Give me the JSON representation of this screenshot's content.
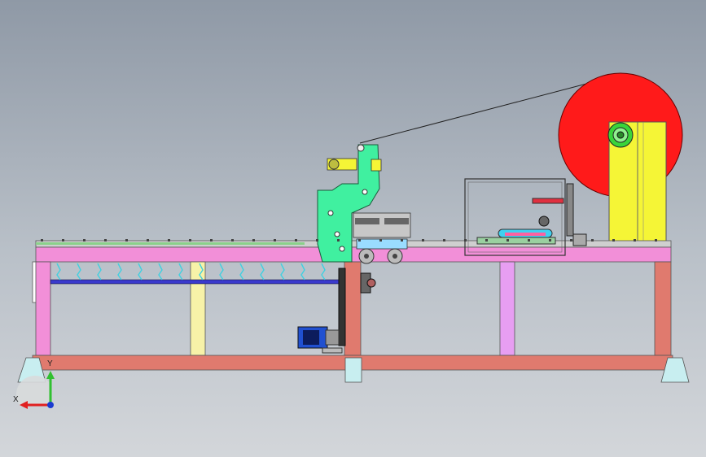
{
  "app": {
    "title": ""
  },
  "triad": {
    "x_label": "X",
    "y_label": "Y"
  },
  "colors": {
    "frame_pink": "#f28fd8",
    "frame_salmon": "#e07a6e",
    "reel_red": "#ff1a1a",
    "reel_yellow": "#f5f536",
    "head_green": "#40f0a0",
    "leg_yellow": "#f7f2a8",
    "leg_violet": "#e79ef2",
    "shaft_blue": "#3a3acc",
    "motor_blue": "#2050d0"
  }
}
